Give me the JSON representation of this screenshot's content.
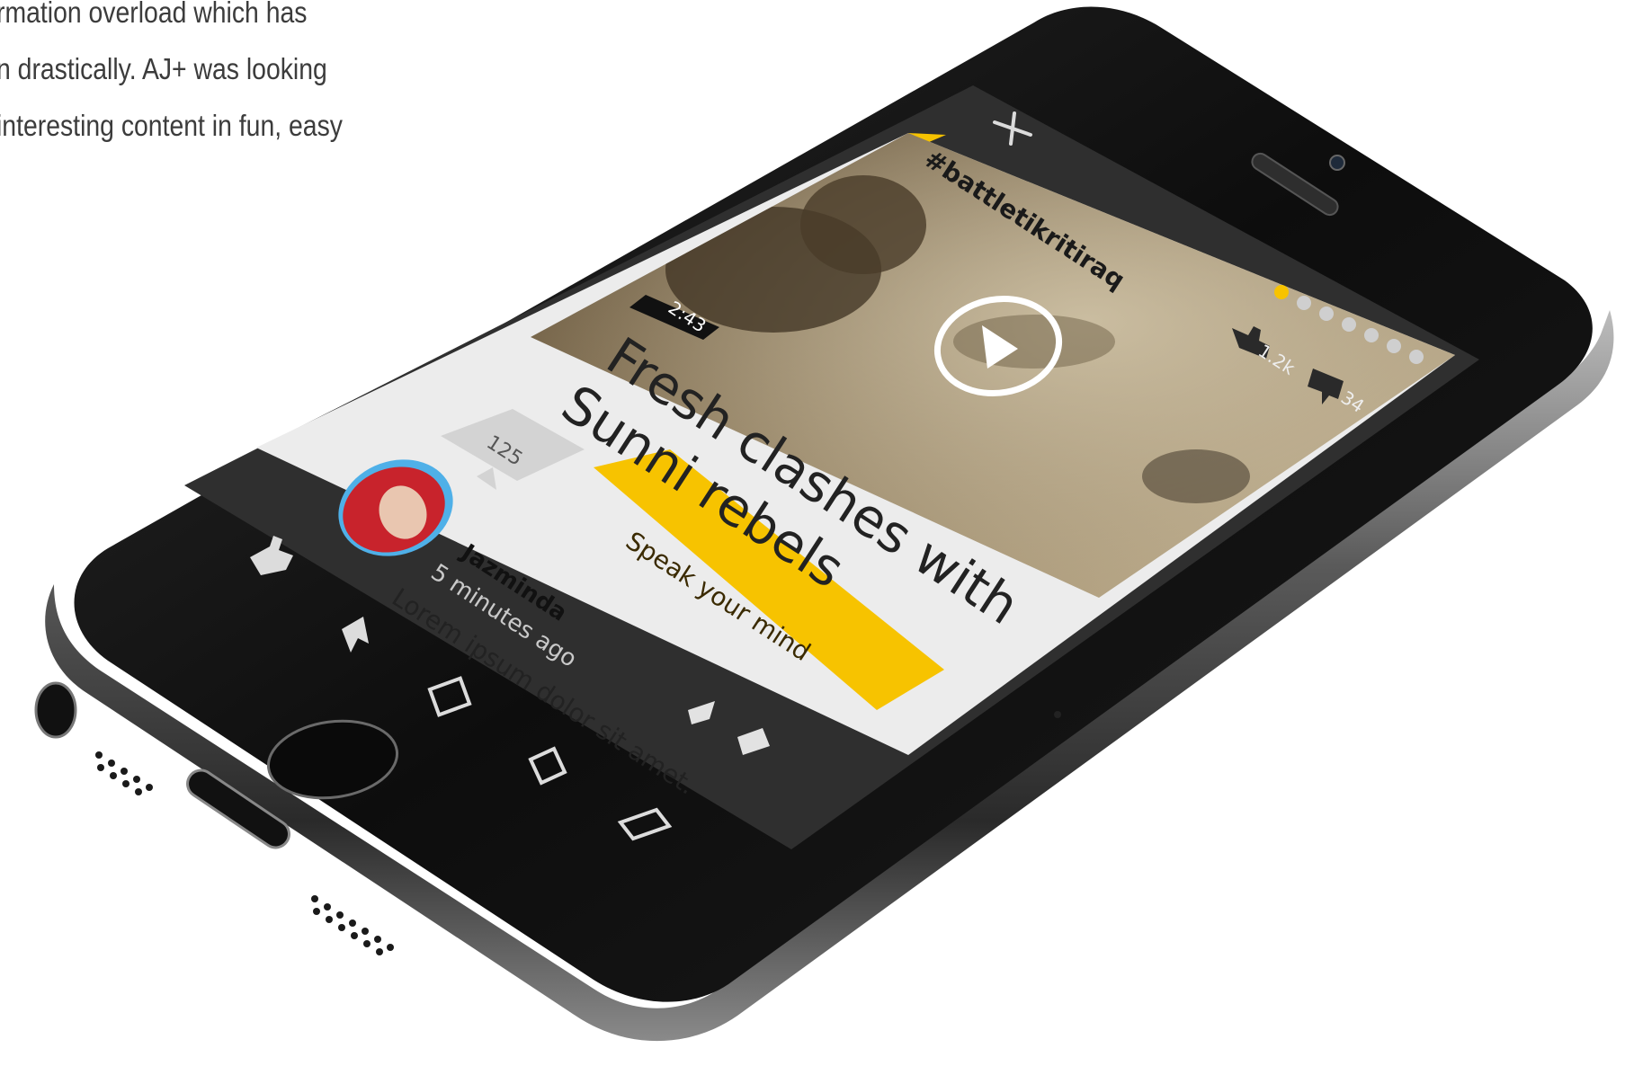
{
  "intro": {
    "lines": [
      "rmation overload which has",
      "n drastically. AJ+ was looking",
      "interesting content in fun, easy"
    ]
  },
  "card": {
    "hashtag": "#battletikritiraq",
    "duration": "2:43",
    "headline_line1": "Fresh clashes with",
    "headline_line2": "Sunni rebels",
    "likes": "1.2k",
    "comments": "34",
    "page_dots_total": 7,
    "page_dots_active": 1
  },
  "discussion": {
    "reply_count": "125",
    "cta_label": "Speak your mind",
    "comment": {
      "user": "Jazminda",
      "time": "5 minutes ago",
      "text": "Lorem ipsum dolor sit amet."
    }
  },
  "icons": {
    "close": "close-icon",
    "like": "thumbs-up-icon",
    "comment": "speech-bubble-icon",
    "bookmark": "bookmark-icon",
    "add": "add-to-list-icon",
    "share": "share-icon",
    "airplay": "airplay-icon",
    "play": "play-icon"
  },
  "colors": {
    "accent_yellow": "#f7c300",
    "phone_body": "#111111",
    "toolbar": "#3a3a3a"
  }
}
